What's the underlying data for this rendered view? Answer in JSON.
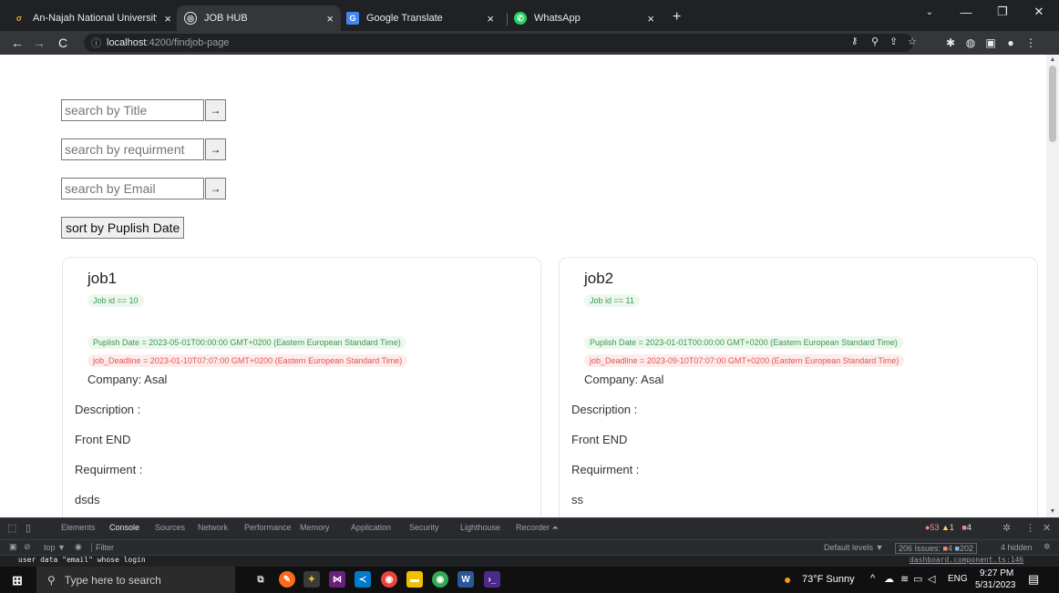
{
  "browser": {
    "tabs": [
      {
        "label": "An-Najah National University ten",
        "close": "×",
        "active": false
      },
      {
        "label": "JOB HUB",
        "close": "×",
        "active": true
      },
      {
        "label": "Google Translate",
        "close": "×",
        "active": false
      },
      {
        "label": "WhatsApp",
        "close": "×",
        "active": false
      }
    ],
    "new_tab": "+",
    "url_host": "localhost",
    "url_path": ":4200/findjob-page"
  },
  "search": {
    "title_placeholder": "search by Title",
    "requirement_placeholder": "search by requirment",
    "email_placeholder": "search by Email",
    "go_label": "→"
  },
  "sort_label": "sort by Puplish Date",
  "jobs": [
    {
      "title": "job1",
      "id_text": "Job id == 10",
      "publish_text": "Puplish Date = 2023-05-01T00:00:00 GMT+0200 (Eastern European Standard Time)",
      "deadline_text": "job_Deadline = 2023-01-10T07:07:00 GMT+0200 (Eastern European Standard Time)",
      "company_text": "Company: Asal",
      "description_label": "Description :",
      "description": "Front END",
      "requirement_label": "Requirment :",
      "requirement": "dsds"
    },
    {
      "title": "job2",
      "id_text": "Job id == 11",
      "publish_text": "Puplish Date = 2023-01-01T00:00:00 GMT+0200 (Eastern European Standard Time)",
      "deadline_text": "job_Deadline = 2023-09-10T07:07:00 GMT+0200 (Eastern European Standard Time)",
      "company_text": "Company: Asal",
      "description_label": "Description :",
      "description": "Front END",
      "requirement_label": "Requirment :",
      "requirement": "ss"
    }
  ],
  "devtools": {
    "tabs": [
      "Elements",
      "Console",
      "Sources",
      "Network",
      "Performance",
      "Memory",
      "Application",
      "Security",
      "Lighthouse",
      "Recorder ⏶"
    ],
    "active_tab": "Console",
    "errors": "53",
    "warnings": "1",
    "messages": "4",
    "context": "top ▼",
    "filter_placeholder": "Filter",
    "levels": "Default levels ▼",
    "issues_label": "206 Issues:",
    "issues_errors": "4",
    "issues_info": "202",
    "hidden": "4 hidden",
    "log_text": "user data \"email\" whose login",
    "log_source": "dashboard.component.ts:146"
  },
  "taskbar": {
    "search_placeholder": "Type here to search",
    "weather": "73°F  Sunny",
    "lang": "ENG",
    "time": "9:27 PM",
    "date": "5/31/2023"
  }
}
